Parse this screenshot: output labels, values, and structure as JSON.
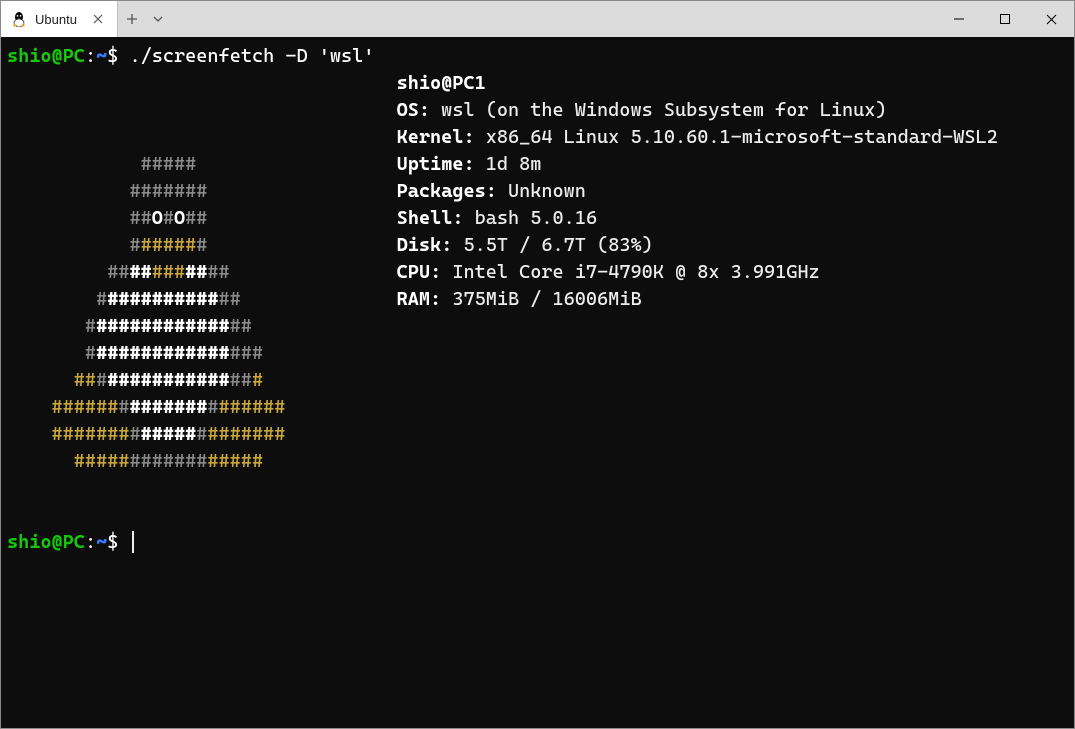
{
  "tab": {
    "label": "Ubuntu"
  },
  "prompt": {
    "user": "shio@PC",
    "sep": ":",
    "path": "~",
    "dollar": "$"
  },
  "command": "./screenfetch -D 'wsl'",
  "info": {
    "title": "shio@PC1",
    "os_k": "OS:",
    "os_v": " wsl (on the Windows Subsystem for Linux)",
    "kernel_k": "Kernel:",
    "kernel_v": " x86_64 Linux 5.10.60.1-microsoft-standard-WSL2",
    "uptime_k": "Uptime:",
    "uptime_v": " 1d 8m",
    "packages_k": "Packages:",
    "packages_v": " Unknown",
    "shell_k": "Shell:",
    "shell_v": " bash 5.0.16",
    "disk_k": "Disk:",
    "disk_v": " 5.5T / 6.7T (83%)",
    "cpu_k": "CPU:",
    "cpu_v": " Intel Core i7-4790K @ 8x 3.991GHz",
    "ram_k": "RAM:",
    "ram_v": " 375MiB / 16006MiB"
  },
  "ascii": {
    "l1_a": "            #####              ",
    "l2_a": "           #######             ",
    "l3_a": "           ##",
    "l3_b": "O",
    "l3_c": "#",
    "l3_d": "O",
    "l3_e": "##             ",
    "l4_a": "           #",
    "l4_b": "#####",
    "l4_c": "#             ",
    "l5_a": "         ##",
    "l5_b": "##",
    "l5_c": "###",
    "l5_d": "##",
    "l5_e": "##           ",
    "l6_a": "        #",
    "l6_b": "##########",
    "l6_c": "##          ",
    "l7_a": "       #",
    "l7_b": "############",
    "l7_c": "##         ",
    "l8_a": "       #",
    "l8_b": "############",
    "l8_c": "###        ",
    "l9_a": "      ##",
    "l9_b": "#",
    "l9_c": "###########",
    "l9_d": "##",
    "l9_e": "#        ",
    "l10_a": "    ######",
    "l10_b": "#",
    "l10_c": "#######",
    "l10_d": "#",
    "l10_e": "######      ",
    "l11_a": "    #######",
    "l11_b": "#",
    "l11_c": "#####",
    "l11_d": "#",
    "l11_e": "#######      ",
    "l12_a": "      #####",
    "l12_b": "#######",
    "l12_c": "#####        "
  }
}
